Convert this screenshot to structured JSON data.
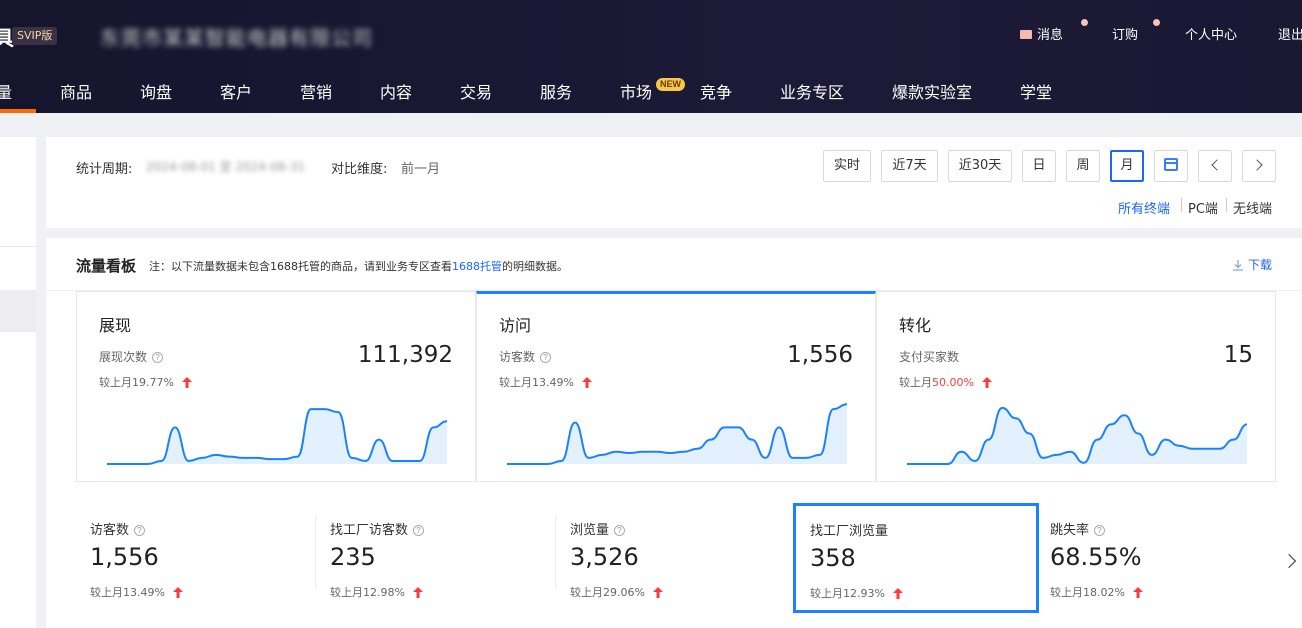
{
  "header": {
    "brand_glyph": "具",
    "svip_badge": "SVIP版",
    "company_name": "东莞市某某智能电器有限公司",
    "top_links": {
      "messages": "消息",
      "orders": "订购",
      "personal_center": "个人中心",
      "logout": "退出"
    }
  },
  "nav": {
    "items": [
      "量",
      "商品",
      "询盘",
      "客户",
      "营销",
      "内容",
      "交易",
      "服务",
      "市场",
      "竞争",
      "业务专区",
      "爆款实验室",
      "学堂"
    ],
    "new_badge": "NEW",
    "accent_color": "#ff6a00"
  },
  "period": {
    "label": "统计周期:",
    "range": "2024-08-01 至 2024-08-31",
    "compare_label": "对比维度:",
    "compare_value": "前一月",
    "buttons": [
      "实时",
      "近7天",
      "近30天",
      "日",
      "周",
      "月"
    ],
    "active_button": "月",
    "terminals": [
      "所有终端",
      "PC端",
      "无线端"
    ],
    "active_terminal": "所有终端"
  },
  "board": {
    "title": "流量看板",
    "note_prefix": "注：以下流量数据未包含1688托管的商品，请到业务专区查看",
    "note_link": "1688托管",
    "note_suffix": "的明细数据。",
    "download": "下载",
    "cards": [
      {
        "title": "展现",
        "metric": "展现次数",
        "value": "111,392",
        "compare_prefix": "较上月",
        "compare_value": "19.77%",
        "trend": "up",
        "highlight": false,
        "spark": [
          0,
          0,
          0,
          0,
          0.05,
          0.6,
          0.05,
          0.1,
          0.15,
          0.12,
          0.1,
          0.1,
          0.08,
          0.08,
          0.12,
          0.9,
          0.9,
          0.85,
          0.1,
          0.05,
          0.4,
          0.05,
          0.05,
          0.05,
          0.6,
          0.7
        ]
      },
      {
        "title": "访问",
        "metric": "访客数",
        "value": "1,556",
        "compare_prefix": "较上月",
        "compare_value": "13.49%",
        "trend": "up",
        "highlight": false,
        "spark": [
          0,
          0,
          0,
          0,
          0.05,
          0.68,
          0.1,
          0.15,
          0.2,
          0.18,
          0.2,
          0.2,
          0.18,
          0.2,
          0.25,
          0.4,
          0.6,
          0.6,
          0.4,
          0.1,
          0.6,
          0.1,
          0.1,
          0.15,
          0.9,
          0.98
        ]
      },
      {
        "title": "转化",
        "metric": "支付买家数",
        "value": "15",
        "compare_prefix": "较上月",
        "compare_value": "50.00%",
        "trend": "up",
        "highlight": true,
        "spark": [
          0,
          0,
          0,
          0,
          0.2,
          0.05,
          0.4,
          0.92,
          0.75,
          0.5,
          0.1,
          0.15,
          0.2,
          0.02,
          0.4,
          0.65,
          0.8,
          0.5,
          0.15,
          0.4,
          0.3,
          0.25,
          0.25,
          0.25,
          0.4,
          0.65
        ]
      }
    ],
    "metrics": [
      {
        "label": "访客数",
        "value": "1,556",
        "compare_prefix": "较上月",
        "compare_value": "13.49%",
        "selected": false
      },
      {
        "label": "找工厂访客数",
        "value": "235",
        "compare_prefix": "较上月",
        "compare_value": "12.98%",
        "selected": false
      },
      {
        "label": "浏览量",
        "value": "3,526",
        "compare_prefix": "较上月",
        "compare_value": "29.06%",
        "selected": false
      },
      {
        "label": "找工厂浏览量",
        "value": "358",
        "compare_prefix": "较上月",
        "compare_value": "12.93%",
        "selected": true
      },
      {
        "label": "跳失率",
        "value": "68.55%",
        "compare_prefix": "较上月",
        "compare_value": "18.02%",
        "selected": false
      }
    ]
  },
  "colors": {
    "primary_blue": "#1a82ff",
    "link_blue": "#1a66ff",
    "up_red": "#ff3a3a",
    "spark_fill": "#e3f0fd",
    "spark_line": "#1a82ff"
  }
}
